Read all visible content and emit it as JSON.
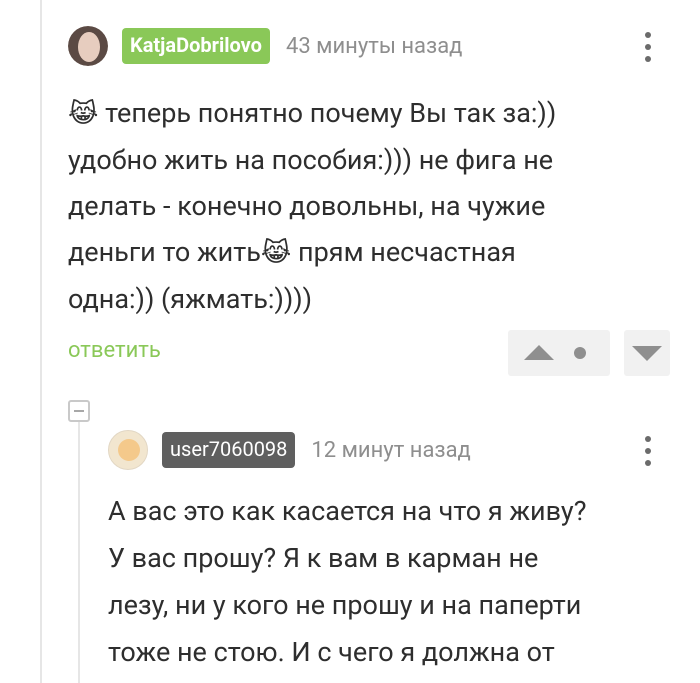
{
  "comment": {
    "author": "KatjaDobrilovo",
    "time": "43 минуты назад",
    "emoji": "😹",
    "lines": [
      "теперь понятно почему Вы так за:))",
      "удобно жить на пособия:))) не фига не",
      "делать - конечно довольны, на чужие",
      "деньги то жить",
      "прям несчастная",
      "одна:)) (яжмать:))))"
    ],
    "reply_label": "ответить"
  },
  "reply": {
    "author": "user7060098",
    "time": "12 минут назад",
    "lines": [
      "А вас это как касается на что я живу?",
      "У вас прошу? Я к вам в карман не",
      "лезу, ни у кого не прошу и на паперти",
      "тоже не стою. И с чего я должна от"
    ]
  },
  "colors": {
    "accent_green": "#8ac858",
    "nick_dark": "#5f5f5f"
  },
  "icons": [
    "more-vertical-icon",
    "vote-up-icon",
    "vote-down-icon",
    "collapse-icon"
  ]
}
